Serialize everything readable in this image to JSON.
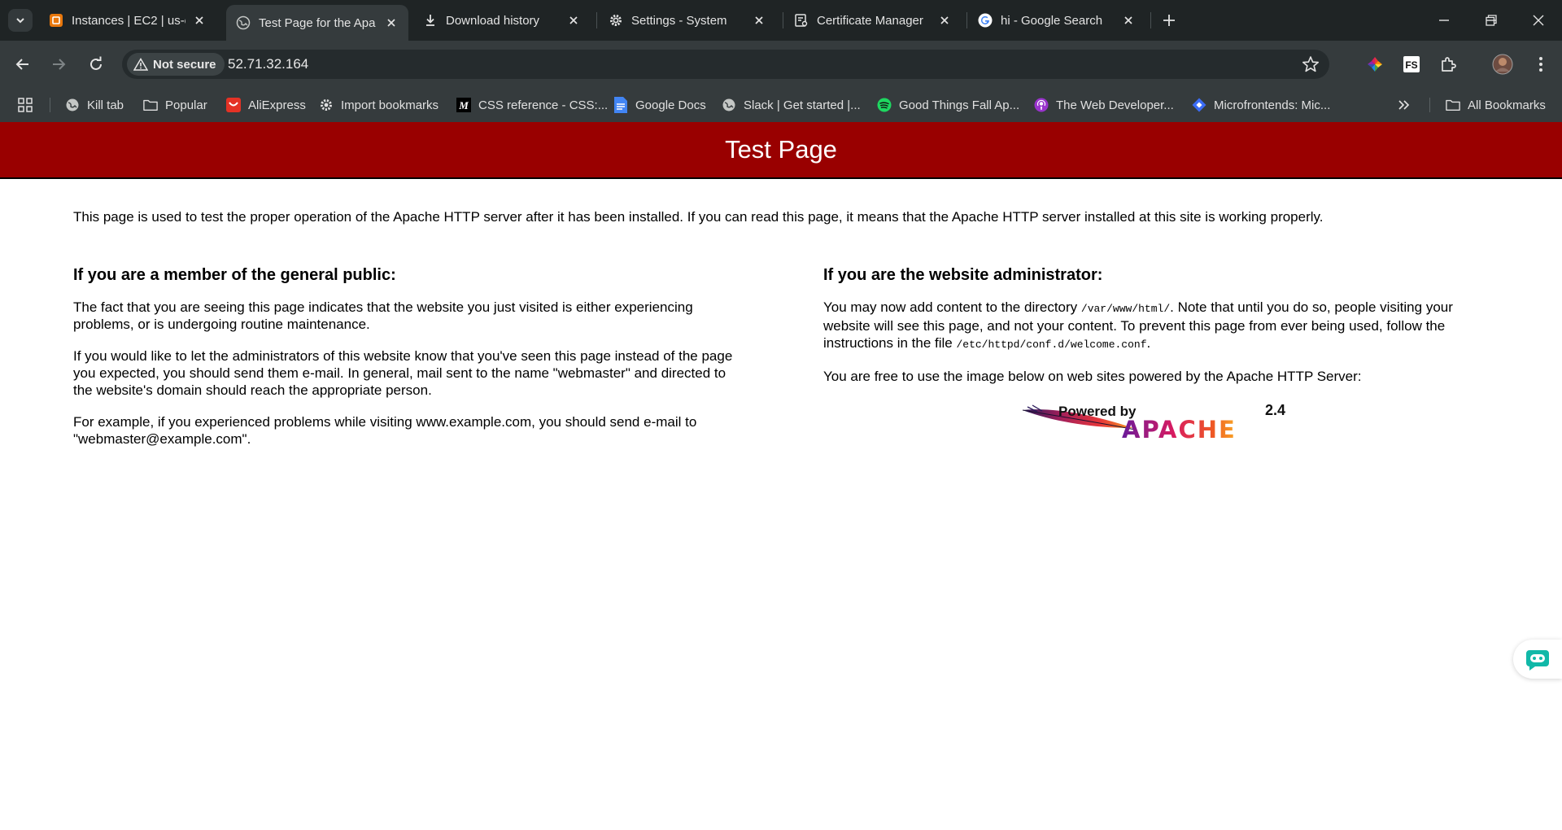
{
  "tabs": [
    {
      "title": "Instances | EC2 | us-e",
      "icon": "aws-icon"
    },
    {
      "title": "Test Page for the Apa",
      "icon": "globe-icon",
      "active": true
    },
    {
      "title": "Download history",
      "icon": "download-icon"
    },
    {
      "title": "Settings - System",
      "icon": "gear-icon"
    },
    {
      "title": "Certificate Manager",
      "icon": "certificate-icon"
    },
    {
      "title": "hi - Google Search",
      "icon": "google-icon"
    }
  ],
  "omnibox": {
    "security_label": "Not secure",
    "url": "52.71.32.164"
  },
  "bookmarks": [
    {
      "label": "Kill tab",
      "icon": "globe-icon"
    },
    {
      "label": "Popular",
      "icon": "folder-icon"
    },
    {
      "label": "AliExpress",
      "icon": "aliexpress-icon"
    },
    {
      "label": "Import bookmarks",
      "icon": "gear-icon"
    },
    {
      "label": "CSS reference - CSS:...",
      "icon": "mdn-icon"
    },
    {
      "label": "Google Docs",
      "icon": "docs-icon"
    },
    {
      "label": "Slack | Get started |...",
      "icon": "globe-icon"
    },
    {
      "label": "Good Things Fall Ap...",
      "icon": "spotify-icon"
    },
    {
      "label": "The Web Developer...",
      "icon": "podcast-icon"
    },
    {
      "label": "Microfrontends: Mic...",
      "icon": "diamond-icon"
    }
  ],
  "all_bookmarks_label": "All Bookmarks",
  "page": {
    "title": "Test Page",
    "intro": "This page is used to test the proper operation of the Apache HTTP server after it has been installed. If you can read this page, it means that the Apache HTTP server installed at this site is working properly.",
    "public": {
      "heading": "If you are a member of the general public:",
      "p1": "The fact that you are seeing this page indicates that the website you just visited is either experiencing problems, or is undergoing routine maintenance.",
      "p2": "If you would like to let the administrators of this website know that you've seen this page instead of the page you expected, you should send them e-mail. In general, mail sent to the name \"webmaster\" and directed to the website's domain should reach the appropriate person.",
      "p3": "For example, if you experienced problems while visiting www.example.com, you should send e-mail to \"webmaster@example.com\"."
    },
    "admin": {
      "heading": "If you are the website administrator:",
      "p1_a": "You may now add content to the directory ",
      "p1_code1": "/var/www/html/",
      "p1_b": ". Note that until you do so, people visiting your website will see this page, and not your content. To prevent this page from ever being used, follow the instructions in the file ",
      "p1_code2": "/etc/httpd/conf.d/welcome.conf",
      "p1_c": ".",
      "p2": "You are free to use the image below on web sites powered by the Apache HTTP Server:"
    },
    "logo": {
      "powered_by": "Powered by",
      "version": "2.4",
      "name": "APACHE"
    }
  },
  "colors": {
    "banner": "#990000",
    "chrome_dark": "#1f2425",
    "toolbar": "#353b3d"
  }
}
